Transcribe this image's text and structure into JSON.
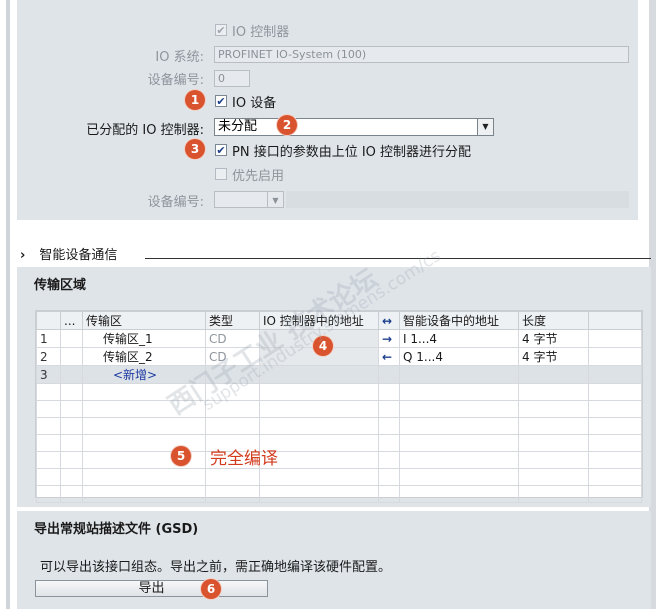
{
  "io_section": {
    "io_controller_cb": "IO 控制器",
    "io_system_label": "IO 系统:",
    "io_system_value": "PROFINET IO-System (100)",
    "device_number_label": "设备编号:",
    "device_number_value": "0",
    "io_device_cb": "IO 设备",
    "assigned_controller_label": "已分配的 IO 控制器:",
    "assigned_controller_value": "未分配",
    "pn_param_cb": "PN 接口的参数由上位 IO 控制器进行分配",
    "priority_startup_cb": "优先启用",
    "device_number2_label": "设备编号:"
  },
  "badges": [
    "1",
    "2",
    "3",
    "4",
    "5",
    "6"
  ],
  "smart_device": {
    "section_title": "智能设备通信",
    "expander_icon": "chevron-right-icon",
    "expander_glyph": "›",
    "transfer_title": "传输区域",
    "table": {
      "headers": [
        "...",
        "传输区",
        "类型",
        "IO 控制器中的地址",
        "↔",
        "智能设备中的地址",
        "长度"
      ],
      "rows": [
        {
          "idx": "1",
          "name": "传输区_1",
          "type": "CD",
          "ctrl_addr": "",
          "dir": "→",
          "dev_addr": "I 1...4",
          "len": "4 字节"
        },
        {
          "idx": "2",
          "name": "传输区_2",
          "type": "CD",
          "ctrl_addr": "",
          "dir": "←",
          "dev_addr": "Q 1...4",
          "len": "4 字节"
        },
        {
          "idx": "3",
          "name": "<新增>",
          "type": "",
          "ctrl_addr": "",
          "dir": "",
          "dev_addr": "",
          "len": ""
        }
      ]
    },
    "compile_note": "完全编译"
  },
  "gsd": {
    "title": "导出常规站描述文件 (GSD)",
    "description": "可以导出该接口组态。导出之前，需正确地编译该硬件配置。",
    "export_button": "导出"
  },
  "watermark": {
    "line1": "西门子工业  技术论坛",
    "line2": "support.industry.siemens.com/cs"
  },
  "colors": {
    "badge": "#d9532f",
    "compile_note": "#d23a1c",
    "panel": "#dfe4e9"
  }
}
